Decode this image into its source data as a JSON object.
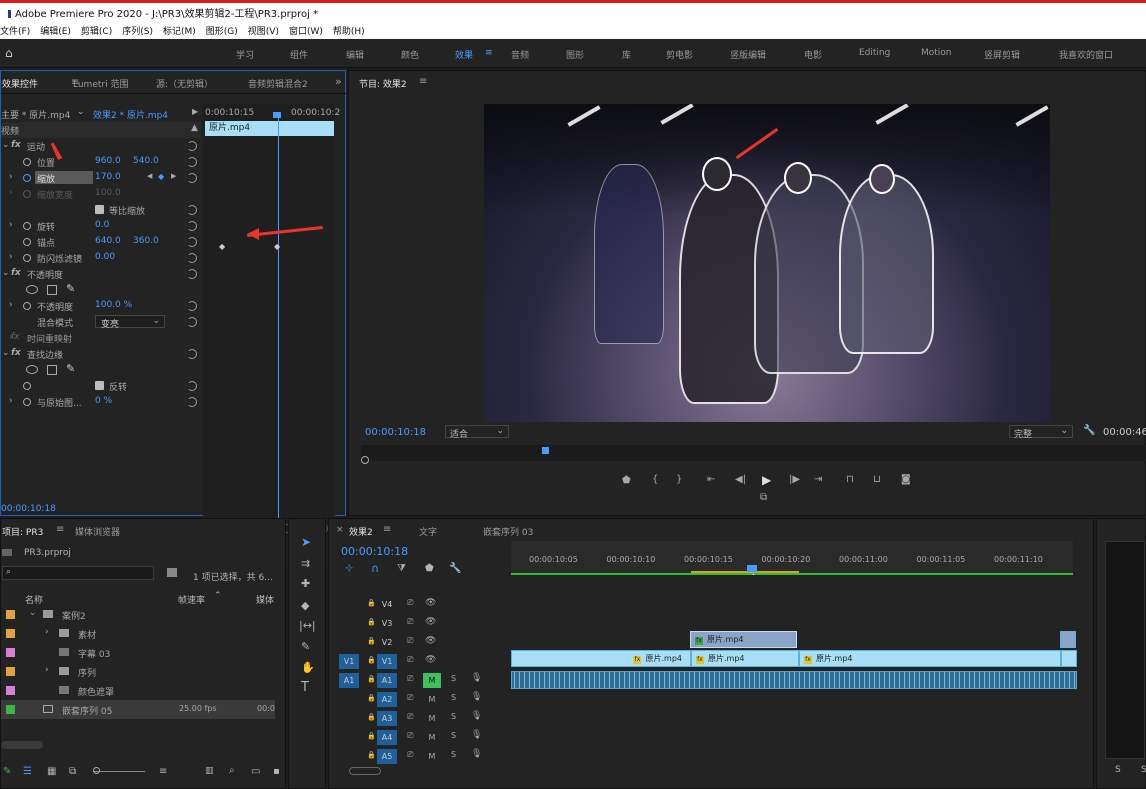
{
  "app": {
    "title": "Adobe Premiere Pro 2020 - J:\\PR3\\效果剪辑2-工程\\PR3.prproj *"
  },
  "menu": [
    "文件(F)",
    "编辑(E)",
    "剪辑(C)",
    "序列(S)",
    "标记(M)",
    "图形(G)",
    "视图(V)",
    "窗口(W)",
    "帮助(H)"
  ],
  "workspaces": [
    "学习",
    "组件",
    "编辑",
    "颜色",
    "效果",
    "音频",
    "图形",
    "库",
    "剪电影",
    "竖版编辑",
    "电影",
    "Editing",
    "Motion",
    "竖屏剪辑",
    "我喜欢的窗口"
  ],
  "effectControls": {
    "tabs": [
      "效果控件",
      "Lumetri 范围",
      "源:（无剪辑）",
      "音频剪辑混合2"
    ],
    "source": "主要 * 原片.mp4",
    "sequenceClip": "效果2 * 原片.mp4",
    "timeStart": "0:00:10:15",
    "timeEnd": "00:00:10:2",
    "clipName": "原片.mp4",
    "section": "视频",
    "motion": "运动",
    "position": {
      "label": "位置",
      "x": "960.0",
      "y": "540.0"
    },
    "scale": {
      "label": "缩放",
      "value": "170.0"
    },
    "scaleWidth": {
      "label": "缩放宽度",
      "value": "100.0"
    },
    "uniformScale": "等比缩放",
    "rotation": {
      "label": "旋转",
      "value": "0.0"
    },
    "anchor": {
      "label": "锚点",
      "x": "640.0",
      "y": "360.0"
    },
    "antiFlicker": {
      "label": "防闪烁滤镜",
      "value": "0.00"
    },
    "opacitySection": "不透明度",
    "opacity": {
      "label": "不透明度",
      "value": "100.0 %"
    },
    "blendMode": {
      "label": "混合模式",
      "value": "变亮"
    },
    "timeRemap": "时间重映射",
    "findEdges": "查找边缘",
    "invert": "反转",
    "blendWithOriginal": {
      "label": "与原始图...",
      "value": "0 %"
    },
    "currentTime": "00:00:10:18"
  },
  "program": {
    "tab": "节目: 效果2",
    "timecode": "00:00:10:18",
    "fit": "适合",
    "quality": "完整",
    "duration": "00:00:46"
  },
  "project": {
    "tabs": [
      "项目: PR3",
      "媒体浏览器"
    ],
    "file": "PR3.prproj",
    "selection": "1 项已选择，共 6...",
    "columns": {
      "name": "名称",
      "fps": "帧速率",
      "media": "媒体"
    },
    "items": [
      {
        "name": "案例2",
        "color": "#e3a33c",
        "type": "folder",
        "indent": 0
      },
      {
        "name": "素材",
        "color": "#e3a33c",
        "type": "folder",
        "indent": 1
      },
      {
        "name": "字幕 03",
        "color": "#d77fd6",
        "type": "title",
        "indent": 1
      },
      {
        "name": "序列",
        "color": "#e3a33c",
        "type": "folder",
        "indent": 1
      },
      {
        "name": "颜色遮罩",
        "color": "#d77fd6",
        "type": "matte",
        "indent": 1
      },
      {
        "name": "嵌套序列 05",
        "color": "#3fb442",
        "type": "sequence",
        "indent": 0,
        "fps": "25.00 fps",
        "media": "00:0"
      }
    ]
  },
  "timeline": {
    "tabs": [
      "效果2",
      "文字",
      "嵌套序列 03"
    ],
    "timecode": "00:00:10:18",
    "ruler": [
      "00:00:10:05",
      "00:00:10:10",
      "00:00:10:15",
      "00:00:10:20",
      "00:00:11:00",
      "00:00:11:05",
      "00:00:11:10"
    ],
    "videoTracks": [
      "V4",
      "V3",
      "V2",
      "V1"
    ],
    "audioTracks": [
      "A1",
      "A2",
      "A3",
      "A4",
      "A5"
    ],
    "clipName": "原片.mp4",
    "mute": "M",
    "solo": "S"
  },
  "colors": {
    "accent": "#4a9bff",
    "clip": "#a7dff6",
    "fxBadge": "#e6c534",
    "audio": "#2e6e96"
  }
}
